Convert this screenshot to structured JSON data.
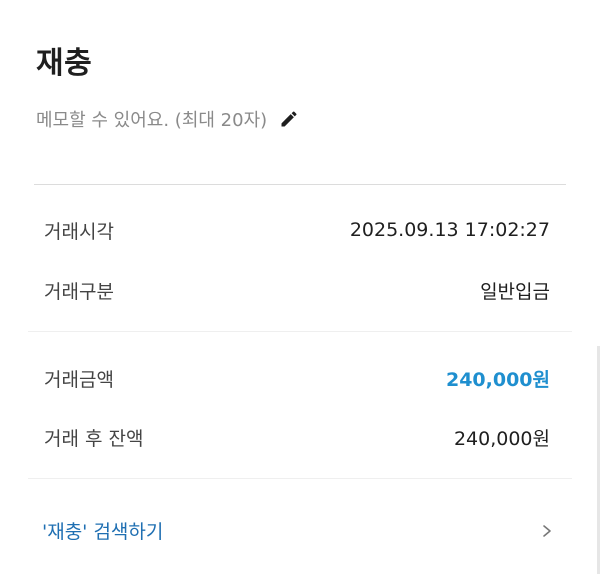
{
  "header": {
    "title": "재충"
  },
  "memo": {
    "placeholder_text": "메모할 수 있어요. (최대 20자)",
    "edit_icon": "pencil-icon"
  },
  "details": {
    "time_label": "거래시각",
    "time_value": "2025.09.13 17:02:27",
    "type_label": "거래구분",
    "type_value": "일반입금",
    "amount_label": "거래금액",
    "amount_value": "240,000원",
    "balance_label": "거래 후 잔액",
    "balance_value": "240,000원"
  },
  "search": {
    "label": "'재충' 검색하기",
    "chevron_icon": "chevron-right-icon"
  },
  "colors": {
    "accent": "#1f8fcf",
    "link": "#1f6fb2",
    "muted": "#8a8a8a"
  }
}
